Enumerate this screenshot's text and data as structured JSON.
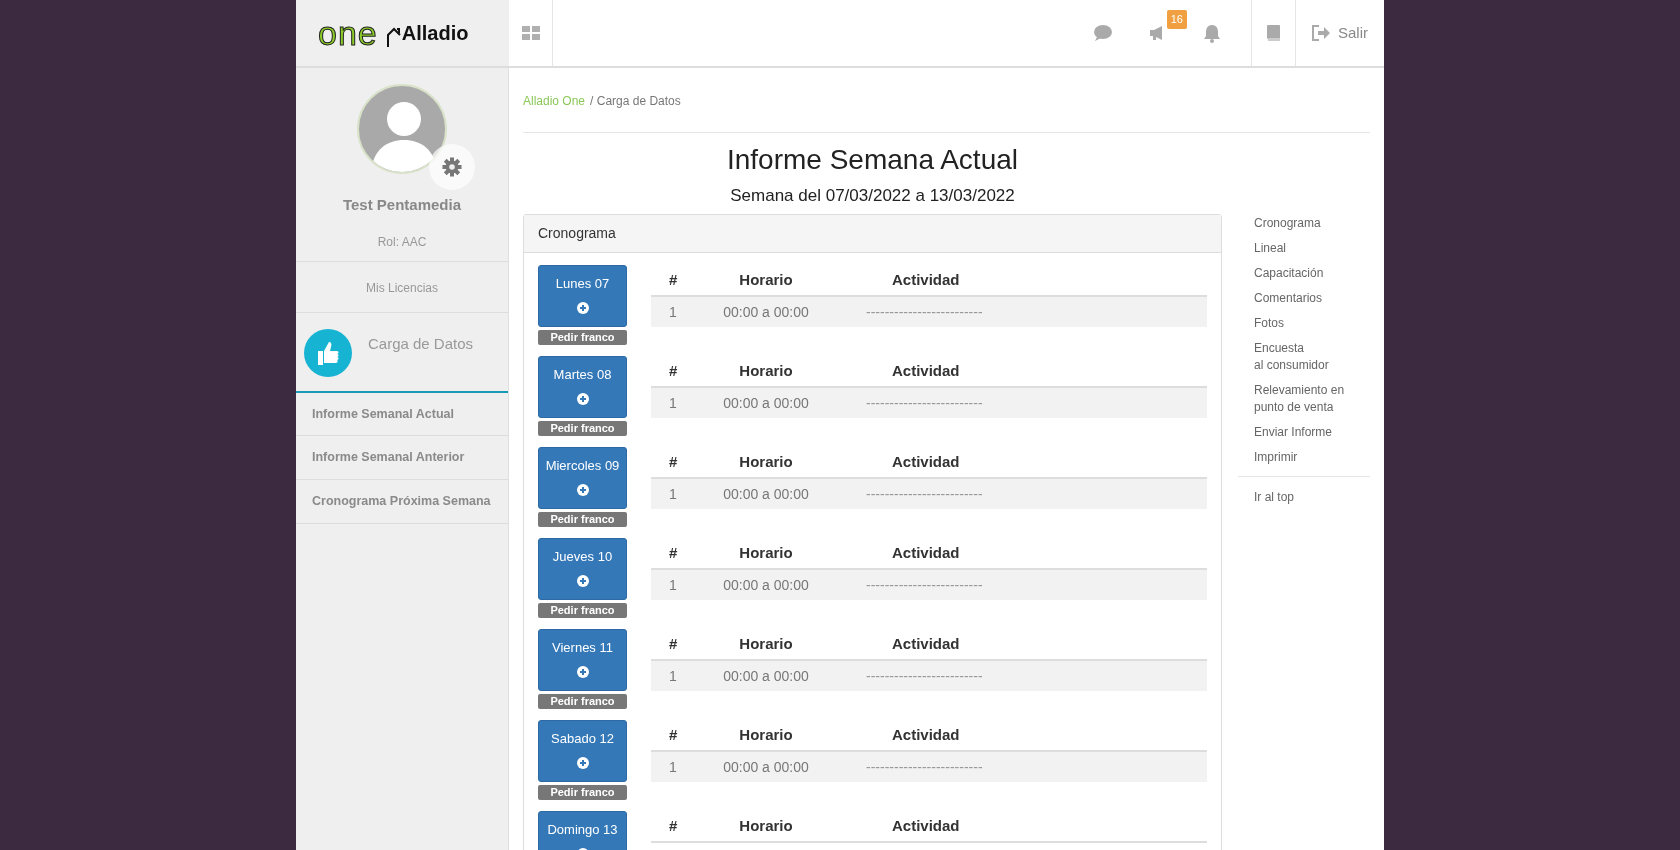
{
  "header": {
    "logo_one": "one",
    "logo_brand": "Alladio",
    "notification_count": "16",
    "logout": "Salir"
  },
  "sidebar": {
    "user_name": "Test Pentamedia",
    "role": "Rol: AAC",
    "licenses": "Mis Licencias",
    "section": "Carga de Datos",
    "items": [
      {
        "label": "Informe Semanal Actual"
      },
      {
        "label": "Informe Semanal Anterior"
      },
      {
        "label": "Cronograma Próxima Semana"
      }
    ]
  },
  "breadcrumb": {
    "link": "Alladio One",
    "separator": "/",
    "current": "Carga de Datos"
  },
  "title": "Informe Semana Actual",
  "subtitle": "Semana del 07/03/2022 a 13/03/2022",
  "panel": {
    "title": "Cronograma",
    "days": [
      {
        "label": "Lunes 07",
        "action": "Pedir franco",
        "columns": [
          "#",
          "Horario",
          "Actividad"
        ],
        "rows": [
          [
            "1",
            "00:00 a 00:00",
            "-------------------------"
          ]
        ]
      },
      {
        "label": "Martes 08",
        "action": "Pedir franco",
        "columns": [
          "#",
          "Horario",
          "Actividad"
        ],
        "rows": [
          [
            "1",
            "00:00 a 00:00",
            "-------------------------"
          ]
        ]
      },
      {
        "label": "Miercoles 09",
        "action": "Pedir franco",
        "columns": [
          "#",
          "Horario",
          "Actividad"
        ],
        "rows": [
          [
            "1",
            "00:00 a 00:00",
            "-------------------------"
          ]
        ]
      },
      {
        "label": "Jueves 10",
        "action": "Pedir franco",
        "columns": [
          "#",
          "Horario",
          "Actividad"
        ],
        "rows": [
          [
            "1",
            "00:00 a 00:00",
            "-------------------------"
          ]
        ]
      },
      {
        "label": "Viernes 11",
        "action": "Pedir franco",
        "columns": [
          "#",
          "Horario",
          "Actividad"
        ],
        "rows": [
          [
            "1",
            "00:00 a 00:00",
            "-------------------------"
          ]
        ]
      },
      {
        "label": "Sabado 12",
        "action": "Pedir franco",
        "columns": [
          "#",
          "Horario",
          "Actividad"
        ],
        "rows": [
          [
            "1",
            "00:00 a 00:00",
            "-------------------------"
          ]
        ]
      },
      {
        "label": "Domingo 13",
        "columns": [
          "#",
          "Horario",
          "Actividad"
        ]
      }
    ]
  },
  "right_nav": {
    "items": [
      "Cronograma",
      "Lineal",
      "Capacitación",
      "Comentarios",
      "Fotos",
      "Encuesta\nal consumidor",
      "Relevamiento en\npunto de venta",
      "Enviar Informe",
      "Imprimir"
    ],
    "bottom": "Ir al top"
  }
}
